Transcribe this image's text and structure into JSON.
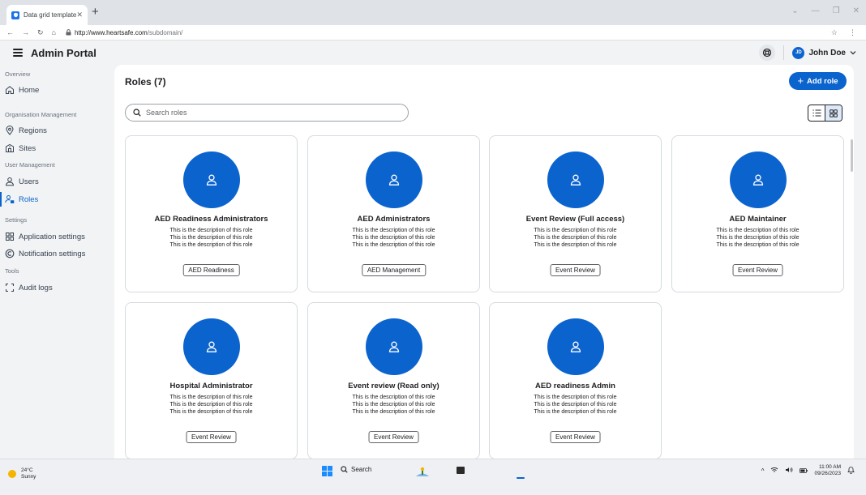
{
  "browser": {
    "tab_title": "Data grid template",
    "url_host": "http://www.heartsafe.com",
    "url_path": "/subdomain/"
  },
  "header": {
    "app_title": "Admin Portal",
    "user_initials": "JD",
    "user_name": "John Doe"
  },
  "sidebar": {
    "overview_label": "Overview",
    "home": "Home",
    "org_label": "Organisation Management",
    "regions": "Regions",
    "sites": "Sites",
    "user_label": "User Management",
    "users": "Users",
    "roles": "Roles",
    "settings_label": "Settings",
    "app_settings": "Application settings",
    "notif_settings": "Notification settings",
    "tools_label": "Tools",
    "audit_logs": "Audit logs",
    "active_item": "Roles"
  },
  "main": {
    "title": "Roles (7)",
    "add_button": "Add role",
    "search_placeholder": "Search roles",
    "view_mode": "grid"
  },
  "roles": [
    {
      "name": "AED Readiness Administrators",
      "desc": [
        "This is the description of this role",
        "This is the description of this role",
        "This is the description of this role"
      ],
      "tag": "AED Readiness"
    },
    {
      "name": "AED Administrators",
      "desc": [
        "This is the description of this role",
        "This is the description of this role",
        "This is the description of this role"
      ],
      "tag": "AED Management"
    },
    {
      "name": "Event Review (Full access)",
      "desc": [
        "This is the description of this role",
        "This is the description of this role",
        "This is the description of this role"
      ],
      "tag": "Event Review"
    },
    {
      "name": "AED Maintainer",
      "desc": [
        "This is the description of this role",
        "This is the description of this role",
        "This is the description of this role"
      ],
      "tag": "Event Review"
    },
    {
      "name": "Hospital Administrator",
      "desc": [
        "This is the description of this role",
        "This is the description of this role",
        "This is the description of this role"
      ],
      "tag": "Event Review"
    },
    {
      "name": "Event review (Read only)",
      "desc": [
        "This is the description of this role",
        "This is the description of this role",
        "This is the description of this role"
      ],
      "tag": "Event Review"
    },
    {
      "name": "AED readiness Admin",
      "desc": [
        "This is the description of this role",
        "This is the description of this role",
        "This is the description of this role"
      ],
      "tag": "Event Review"
    }
  ],
  "taskbar": {
    "temperature": "24°C",
    "weather": "Sunny",
    "search_label": "Search",
    "time": "11:00 AM",
    "date": "09/26/2023"
  },
  "colors": {
    "accent": "#0b63ce",
    "page_bg": "#f1f3f4"
  }
}
